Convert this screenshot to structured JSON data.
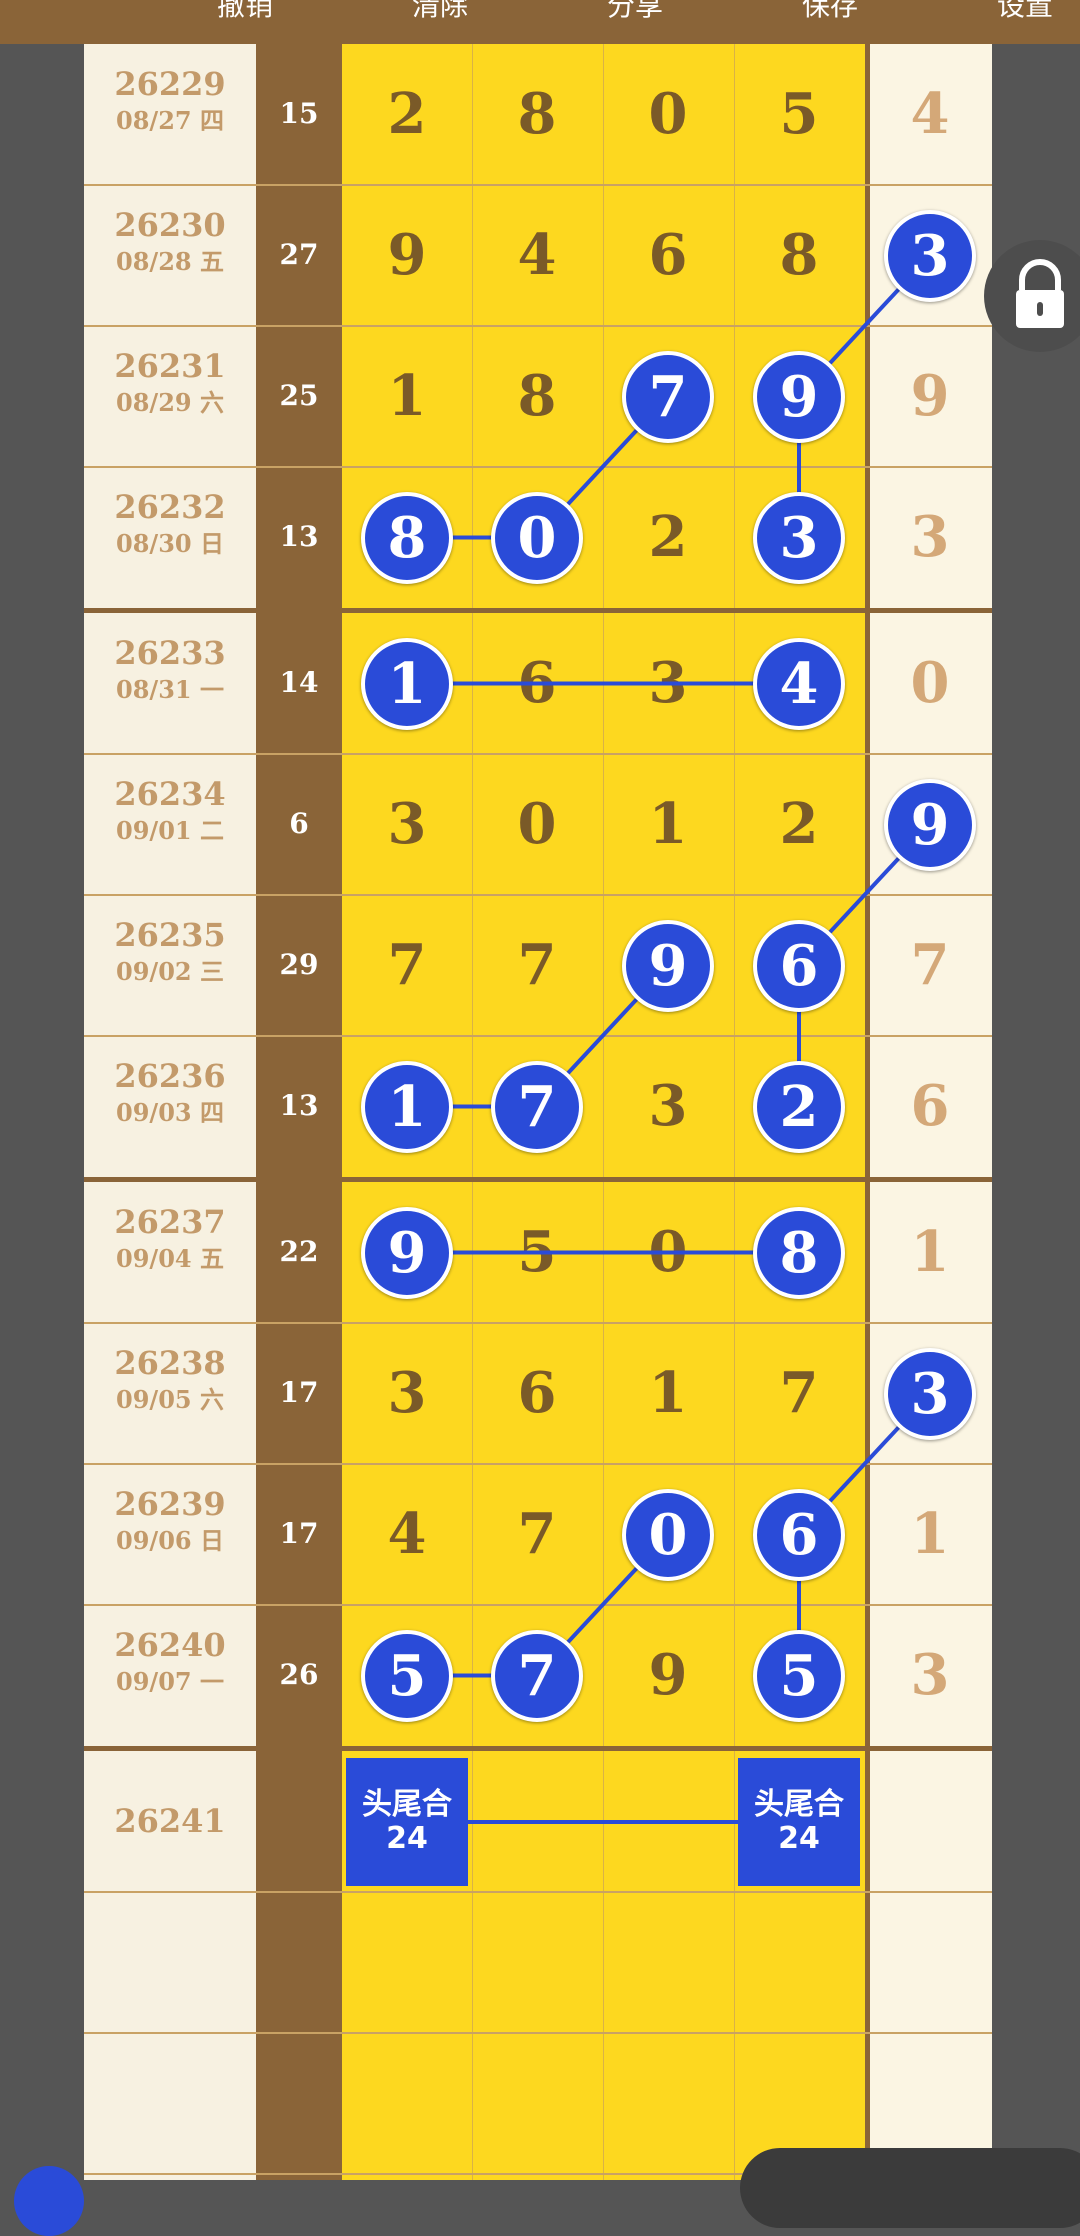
{
  "toolbar": {
    "undo_label": "撤销",
    "clear_label": "清除",
    "share_label": "分享",
    "save_label": "保存",
    "settings_label": "设置"
  },
  "colors": {
    "frame": "#8a6438",
    "grid": "#fdd81f",
    "ball": "#2a4bd8",
    "issue_text": "#c39a6a",
    "digit_text": "#7a5a28",
    "tail_text": "#d4a878"
  },
  "rows": [
    {
      "issue": "26229",
      "date": "08/27 四",
      "sum": "15",
      "digits": [
        "2",
        "8",
        "0",
        "5"
      ],
      "tail": "4",
      "balls": [],
      "tail_ball": false
    },
    {
      "issue": "26230",
      "date": "08/28 五",
      "sum": "27",
      "digits": [
        "9",
        "4",
        "6",
        "8"
      ],
      "tail": "3",
      "balls": [],
      "tail_ball": true
    },
    {
      "issue": "26231",
      "date": "08/29 六",
      "sum": "25",
      "digits": [
        "1",
        "8",
        "7",
        "9"
      ],
      "tail": "9",
      "balls": [
        2,
        3
      ],
      "tail_ball": false
    },
    {
      "issue": "26232",
      "date": "08/30 日",
      "sum": "13",
      "digits": [
        "8",
        "0",
        "2",
        "3"
      ],
      "tail": "3",
      "balls": [
        0,
        1,
        3
      ],
      "tail_ball": false
    },
    {
      "issue": "26233",
      "date": "08/31 一",
      "sum": "14",
      "digits": [
        "1",
        "6",
        "3",
        "4"
      ],
      "tail": "0",
      "balls": [
        0,
        3
      ],
      "tail_ball": false
    },
    {
      "issue": "26234",
      "date": "09/01 二",
      "sum": "6",
      "digits": [
        "3",
        "0",
        "1",
        "2"
      ],
      "tail": "9",
      "balls": [],
      "tail_ball": true
    },
    {
      "issue": "26235",
      "date": "09/02 三",
      "sum": "29",
      "digits": [
        "7",
        "7",
        "9",
        "6"
      ],
      "tail": "7",
      "balls": [
        2,
        3
      ],
      "tail_ball": false
    },
    {
      "issue": "26236",
      "date": "09/03 四",
      "sum": "13",
      "digits": [
        "1",
        "7",
        "3",
        "2"
      ],
      "tail": "6",
      "balls": [
        0,
        1,
        3
      ],
      "tail_ball": false
    },
    {
      "issue": "26237",
      "date": "09/04 五",
      "sum": "22",
      "digits": [
        "9",
        "5",
        "0",
        "8"
      ],
      "tail": "1",
      "balls": [
        0,
        3
      ],
      "tail_ball": false
    },
    {
      "issue": "26238",
      "date": "09/05 六",
      "sum": "17",
      "digits": [
        "3",
        "6",
        "1",
        "7"
      ],
      "tail": "3",
      "balls": [],
      "tail_ball": true
    },
    {
      "issue": "26239",
      "date": "09/06 日",
      "sum": "17",
      "digits": [
        "4",
        "7",
        "0",
        "6"
      ],
      "tail": "1",
      "balls": [
        2,
        3
      ],
      "tail_ball": false
    },
    {
      "issue": "26240",
      "date": "09/07 一",
      "sum": "26",
      "digits": [
        "5",
        "7",
        "9",
        "5"
      ],
      "tail": "3",
      "balls": [
        0,
        1,
        3
      ],
      "tail_ball": false
    }
  ],
  "next_issue": "26241",
  "head_tail_box": {
    "label": "头尾合",
    "value": "24"
  }
}
